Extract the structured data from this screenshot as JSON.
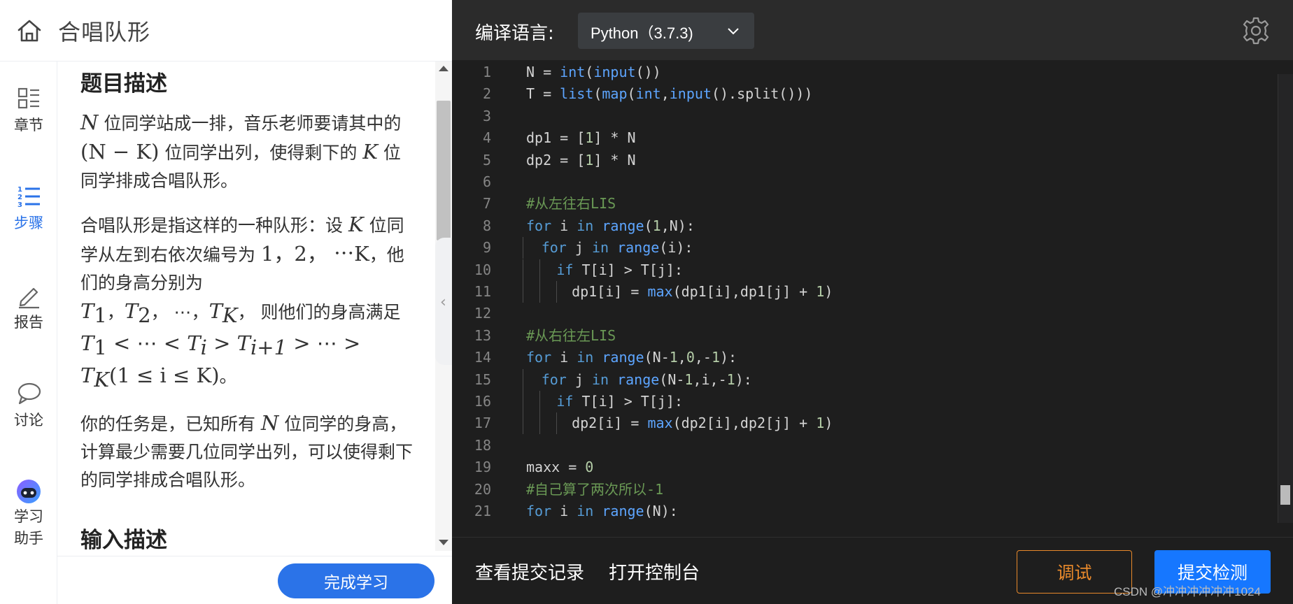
{
  "header": {
    "title": "合唱队形",
    "home_icon": "home-icon"
  },
  "sidebar": {
    "active_color": "#2b73e8",
    "items": [
      {
        "label": "章节",
        "icon": "chapters-icon"
      },
      {
        "label": "步骤",
        "icon": "numbered-list-icon",
        "active": true
      },
      {
        "label": "报告",
        "icon": "pencil-icon"
      },
      {
        "label": "讨论",
        "icon": "chat-bubble-icon"
      },
      {
        "label_line1": "学习",
        "label_line2": "助手",
        "icon": "robot-assistant-icon"
      }
    ]
  },
  "problem": {
    "section1_title": "题目描述",
    "p1": {
      "a": "N",
      "b": " 位同学站成一排，音乐老师要请其中的 ",
      "c": "(N − K)",
      "d": " 位同学出列，使得剩下的 ",
      "e": "K",
      "f": " 位同学排成合唱队形。"
    },
    "p2": {
      "a": "合唱队形是指这样的一种队形：设 ",
      "b": "K",
      "c": " 位同学从左到右依次编号为 ",
      "d": "1，2， ⋯K",
      "e": "，他们的身高分别为",
      "f": "T",
      "f_sub": "1",
      "g": "，",
      "h": "T",
      "h_sub": "2",
      "i": "， ⋯，",
      "j": "T",
      "j_sub": "K",
      "k": "， 则他们的身高满足 ",
      "l": "T",
      "l_sub": "1",
      "m": " < ⋯ < ",
      "n": "T",
      "n_sub": "i",
      "o": " > ",
      "p": "T",
      "p_sub": "i+1",
      "q": " > ⋯ > ",
      "r": "T",
      "r_sub": "K",
      "s": "(1 ≤ i ≤ K)",
      "t": "。"
    },
    "p3": {
      "a": "你的任务是，已知所有 ",
      "b": "N",
      "c": " 位同学的身高，计算最少需要几位同学出列，可以使得剩下的同学排成合唱队形。"
    },
    "section2_title": "输入描述"
  },
  "finish_button": "完成学习",
  "editor": {
    "lang_label": "编译语言:",
    "lang_value": "Python（3.7.3)",
    "settings_icon": "gear-icon",
    "lines": [
      {
        "n": "1",
        "indent": 0,
        "tokens": [
          [
            "",
            "N = "
          ],
          [
            "fn",
            "int"
          ],
          [
            "",
            "("
          ],
          [
            "fn",
            "input"
          ],
          [
            "",
            "())"
          ]
        ]
      },
      {
        "n": "2",
        "indent": 0,
        "tokens": [
          [
            "",
            "T = "
          ],
          [
            "fn",
            "list"
          ],
          [
            "",
            "("
          ],
          [
            "fn",
            "map"
          ],
          [
            "",
            "("
          ],
          [
            "fn",
            "int"
          ],
          [
            "",
            ","
          ],
          [
            "fn",
            "input"
          ],
          [
            "",
            "().split()))"
          ]
        ]
      },
      {
        "n": "3",
        "indent": 0,
        "tokens": []
      },
      {
        "n": "4",
        "indent": 0,
        "tokens": [
          [
            "",
            "dp1 = ["
          ],
          [
            "num",
            "1"
          ],
          [
            "",
            "] * N"
          ]
        ]
      },
      {
        "n": "5",
        "indent": 0,
        "tokens": [
          [
            "",
            "dp2 = ["
          ],
          [
            "num",
            "1"
          ],
          [
            "",
            "] * N"
          ]
        ]
      },
      {
        "n": "6",
        "indent": 0,
        "tokens": []
      },
      {
        "n": "7",
        "indent": 0,
        "tokens": [
          [
            "cm",
            "#从左往右LIS"
          ]
        ]
      },
      {
        "n": "8",
        "indent": 0,
        "tokens": [
          [
            "kw",
            "for"
          ],
          [
            "",
            " i "
          ],
          [
            "kw",
            "in"
          ],
          [
            "",
            " "
          ],
          [
            "fn",
            "range"
          ],
          [
            "",
            "("
          ],
          [
            "num",
            "1"
          ],
          [
            "",
            ",N):"
          ]
        ]
      },
      {
        "n": "9",
        "indent": 1,
        "tokens": [
          [
            "kw",
            "for"
          ],
          [
            "",
            " j "
          ],
          [
            "kw",
            "in"
          ],
          [
            "",
            " "
          ],
          [
            "fn",
            "range"
          ],
          [
            "",
            "(i):"
          ]
        ]
      },
      {
        "n": "10",
        "indent": 2,
        "tokens": [
          [
            "kw",
            "if"
          ],
          [
            "",
            " T[i] > T[j]:"
          ]
        ]
      },
      {
        "n": "11",
        "indent": 3,
        "tokens": [
          [
            "",
            "dp1[i] = "
          ],
          [
            "fn",
            "max"
          ],
          [
            "",
            "(dp1[i],dp1[j] + "
          ],
          [
            "num",
            "1"
          ],
          [
            "",
            ")"
          ]
        ]
      },
      {
        "n": "12",
        "indent": 0,
        "tokens": []
      },
      {
        "n": "13",
        "indent": 0,
        "tokens": [
          [
            "cm",
            "#从右往左LIS"
          ]
        ]
      },
      {
        "n": "14",
        "indent": 0,
        "tokens": [
          [
            "kw",
            "for"
          ],
          [
            "",
            " i "
          ],
          [
            "kw",
            "in"
          ],
          [
            "",
            " "
          ],
          [
            "fn",
            "range"
          ],
          [
            "",
            "(N-"
          ],
          [
            "num",
            "1"
          ],
          [
            "",
            ","
          ],
          [
            "num",
            "0"
          ],
          [
            "",
            ",-"
          ],
          [
            "num",
            "1"
          ],
          [
            "",
            "):"
          ]
        ]
      },
      {
        "n": "15",
        "indent": 1,
        "tokens": [
          [
            "kw",
            "for"
          ],
          [
            "",
            " j "
          ],
          [
            "kw",
            "in"
          ],
          [
            "",
            " "
          ],
          [
            "fn",
            "range"
          ],
          [
            "",
            "(N-"
          ],
          [
            "num",
            "1"
          ],
          [
            "",
            ",i,-"
          ],
          [
            "num",
            "1"
          ],
          [
            "",
            "):"
          ]
        ]
      },
      {
        "n": "16",
        "indent": 2,
        "tokens": [
          [
            "kw",
            "if"
          ],
          [
            "",
            " T[i] > T[j]:"
          ]
        ]
      },
      {
        "n": "17",
        "indent": 3,
        "tokens": [
          [
            "",
            "dp2[i] = "
          ],
          [
            "fn",
            "max"
          ],
          [
            "",
            "(dp2[i],dp2[j] + "
          ],
          [
            "num",
            "1"
          ],
          [
            "",
            ")"
          ]
        ]
      },
      {
        "n": "18",
        "indent": 0,
        "tokens": []
      },
      {
        "n": "19",
        "indent": 0,
        "tokens": [
          [
            "",
            "maxx = "
          ],
          [
            "num",
            "0"
          ]
        ]
      },
      {
        "n": "20",
        "indent": 0,
        "tokens": [
          [
            "cm",
            "#自己算了两次所以-1"
          ]
        ]
      },
      {
        "n": "21",
        "indent": 0,
        "tokens": [
          [
            "kw",
            "for"
          ],
          [
            "",
            " i "
          ],
          [
            "kw",
            "in"
          ],
          [
            "",
            " "
          ],
          [
            "fn",
            "range"
          ],
          [
            "",
            "(N):"
          ]
        ]
      }
    ]
  },
  "footer": {
    "history_link": "查看提交记录",
    "console_link": "打开控制台",
    "debug_button": "调试",
    "submit_button": "提交检测"
  },
  "watermark": "CSDN @冲冲冲冲冲冲1024",
  "colors": {
    "primary": "#2b73e8",
    "submit": "#1677ff",
    "debug": "#e8892b",
    "editor_bg": "#1e1e1e",
    "editor_header": "#2b2b2b"
  }
}
